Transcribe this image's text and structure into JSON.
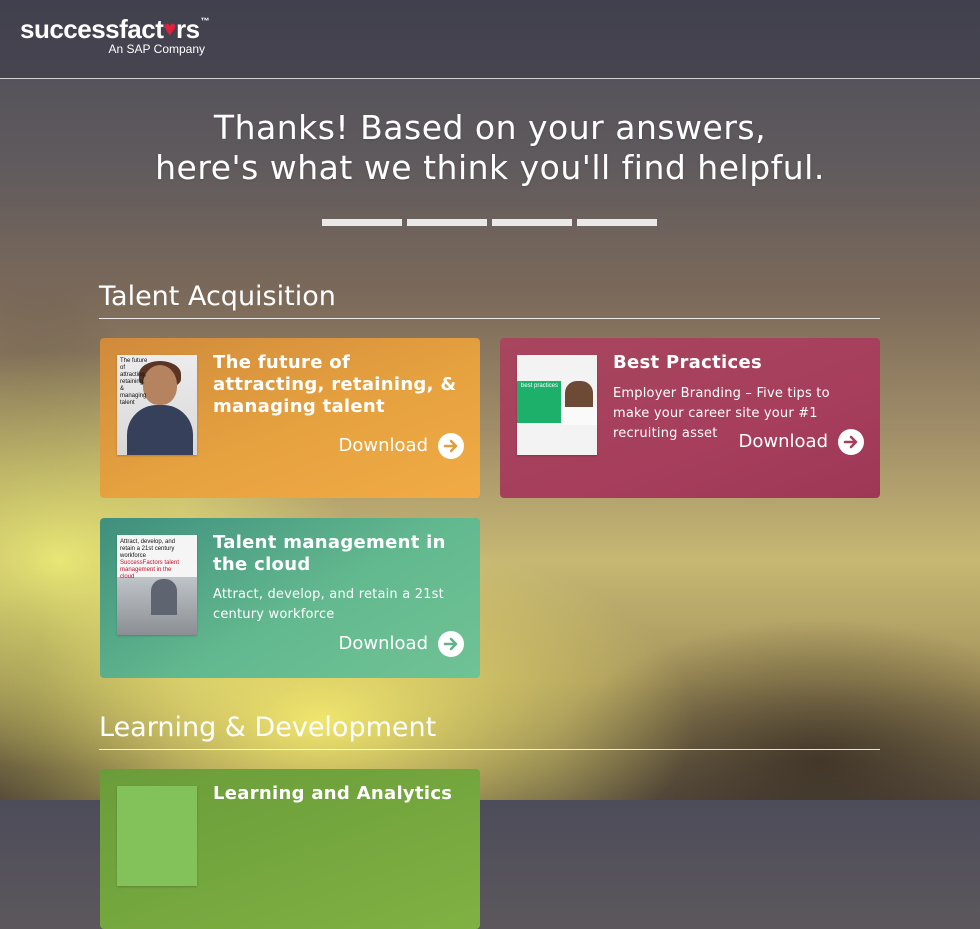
{
  "header": {
    "logo_word_left": "successfact",
    "logo_heart": "♥",
    "logo_word_right": "rs",
    "logo_tm": "™",
    "logo_sub": "An SAP Company"
  },
  "hero": {
    "line1": "Thanks! Based on your answers,",
    "line2": "here's what we think you'll find helpful."
  },
  "progress": {
    "steps": 4
  },
  "sections": [
    {
      "title": "Talent Acquisition",
      "cards": [
        {
          "title": "The future of attracting, retaining, & managing talent",
          "description": "",
          "download": "Download",
          "thumb_text": "The future of attracting, retaining, & managing talent",
          "color": "#e19e3f"
        },
        {
          "title": "Best Practices",
          "description": "Employer Branding – Five tips to make your career site your #1 recruiting asset",
          "download": "Download",
          "thumb_text": "best practices",
          "color": "#a53f5c"
        },
        {
          "title": "Talent management in the cloud",
          "description": "Attract, develop, and retain a 21st century workforce",
          "download": "Download",
          "thumb_text": "Attract, develop, and retain a 21st century workforce",
          "thumb_text_red": "SuccessFactors talent management in the cloud",
          "color": "#5fb48c"
        }
      ]
    },
    {
      "title": "Learning & Development",
      "cards": [
        {
          "title": "Learning and Analytics",
          "color": "#79ab42"
        }
      ]
    }
  ]
}
